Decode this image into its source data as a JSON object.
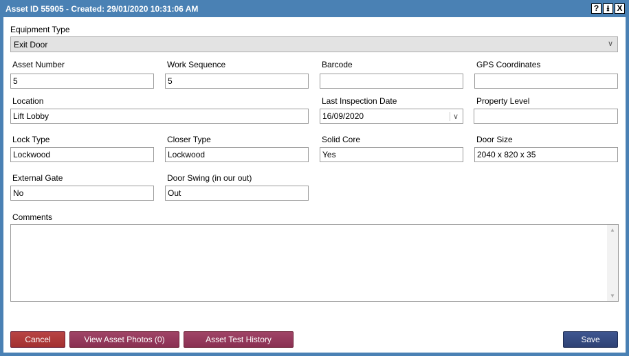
{
  "window": {
    "title": "Asset ID 55905 - Created: 29/01/2020 10:31:06 AM",
    "help": "?",
    "download": "⭳",
    "close": "X"
  },
  "equipment_type": {
    "label": "Equipment Type",
    "value": "Exit Door"
  },
  "fields": [
    {
      "label": "Asset Number",
      "value": "5"
    },
    {
      "label": "Work Sequence",
      "value": "5"
    },
    {
      "label": "Barcode",
      "value": ""
    },
    {
      "label": "GPS Coordinates",
      "value": ""
    },
    {
      "label": "Location",
      "value": "Lift Lobby"
    },
    {
      "label": "Last Inspection Date",
      "value": "16/09/2020"
    },
    {
      "label": "Property Level",
      "value": ""
    },
    {
      "label": "Lock Type",
      "value": "Lockwood"
    },
    {
      "label": "Closer Type",
      "value": "Lockwood"
    },
    {
      "label": "Solid Core",
      "value": "Yes"
    },
    {
      "label": "Door Size",
      "value": "2040 x 820 x 35"
    },
    {
      "label": "External Gate",
      "value": "No"
    },
    {
      "label": "Door Swing (in our out)",
      "value": "Out"
    }
  ],
  "comments": {
    "label": "Comments",
    "value": ""
  },
  "buttons": {
    "cancel": "Cancel",
    "photos": "View Asset Photos (0)",
    "history": "Asset Test History",
    "save": "Save"
  },
  "colors": {
    "titlebar": "#4a81b4",
    "cancel": "#b03a3a",
    "secondary": "#93395a",
    "save": "#34497f"
  }
}
